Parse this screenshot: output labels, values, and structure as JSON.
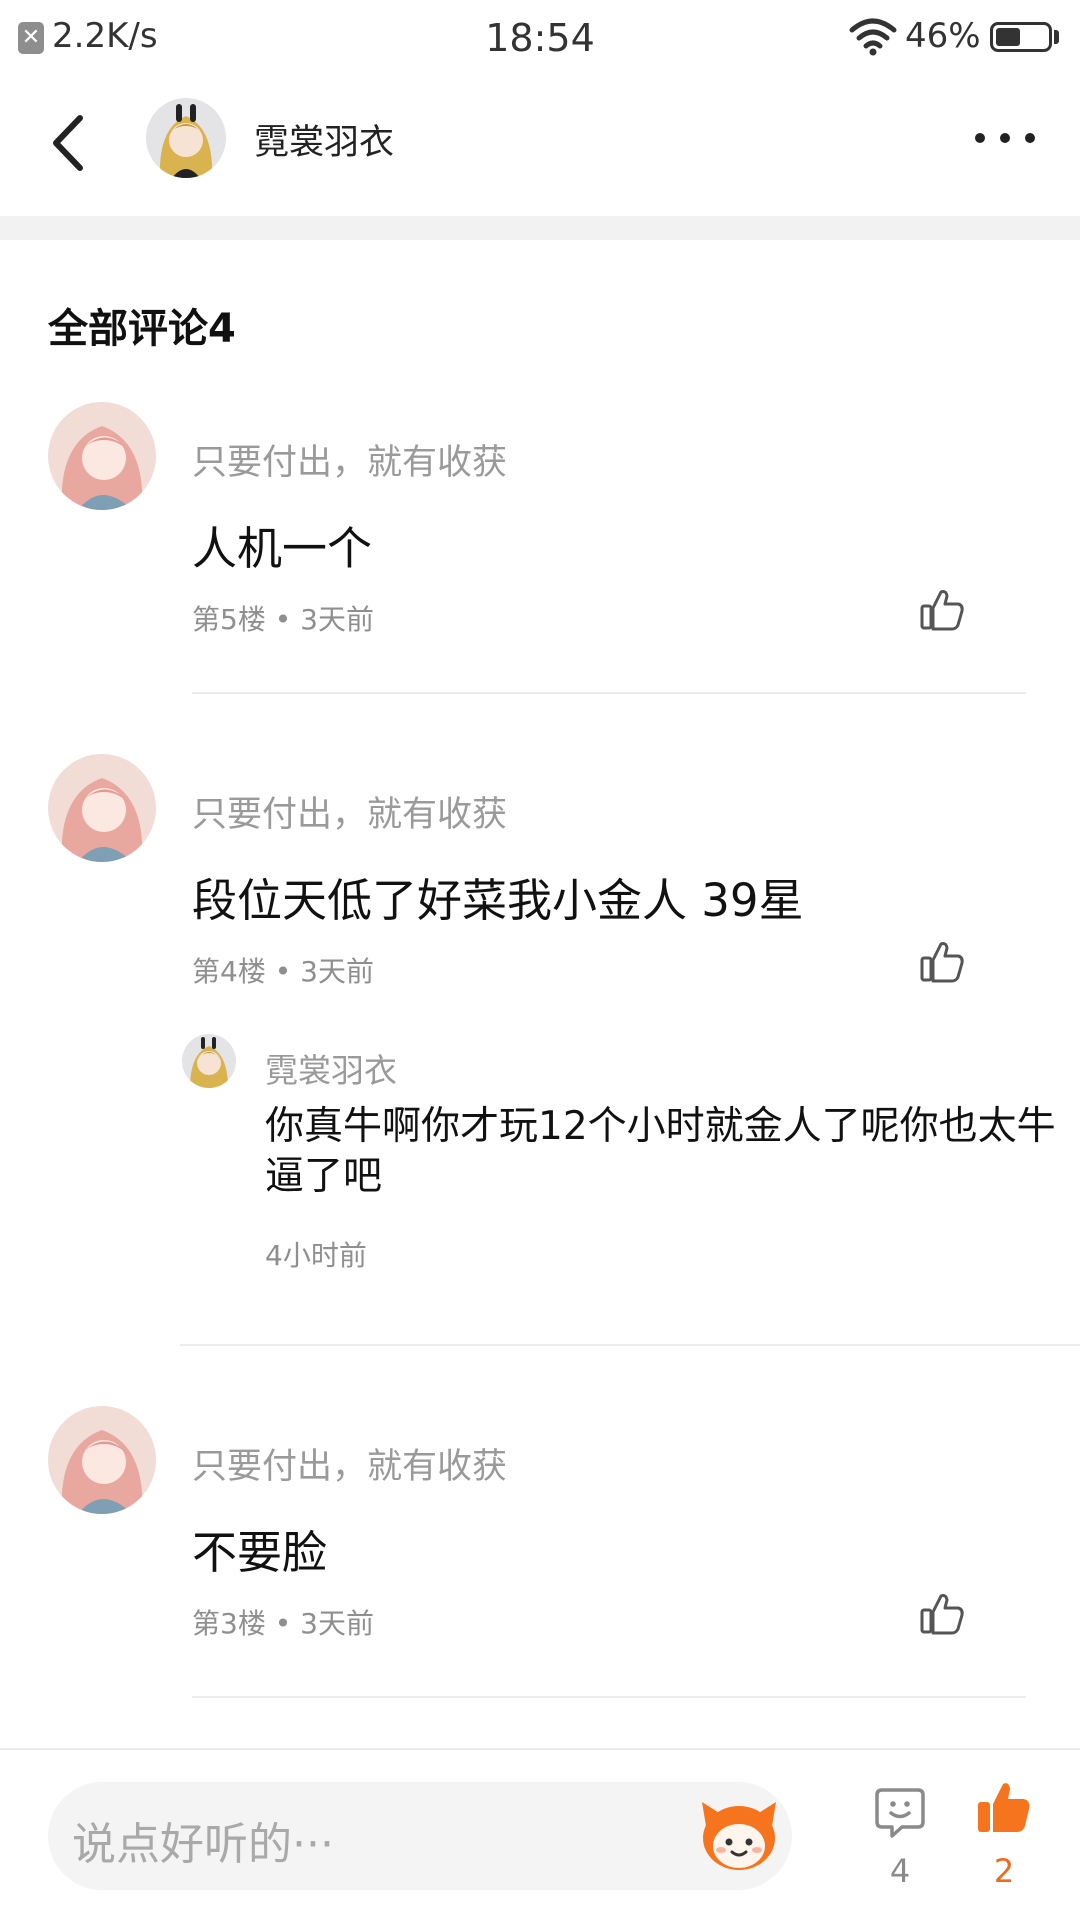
{
  "status_bar": {
    "close_glyph": "✕",
    "net_speed": "2.2K/s",
    "time": "18:54",
    "battery_percent": "46%",
    "battery_level": 0.46
  },
  "nav": {
    "back_icon": "chevron-left-icon",
    "title": "霓裳羽衣",
    "more_icon": "more-dots-icon"
  },
  "section": {
    "title": "全部评论4"
  },
  "comments": [
    {
      "user": "只要付出，就有收获",
      "text": "人机一个",
      "meta": "第5楼 • 3天前"
    },
    {
      "user": "只要付出，就有收获",
      "text": "段位天低了好菜我小金人 39星",
      "meta": "第4楼 • 3天前",
      "reply": {
        "user": "霓裳羽衣",
        "text": "你真牛啊你才玩12个小时就金人了呢你也太牛逼了吧",
        "meta": "4小时前"
      }
    },
    {
      "user": "只要付出，就有收获",
      "text": "不要脸",
      "meta": "第3楼 • 3天前"
    }
  ],
  "bottom_bar": {
    "input_placeholder": "说点好听的···",
    "comment_count": "4",
    "like_count": "2",
    "accent_color": "#f7741e"
  }
}
